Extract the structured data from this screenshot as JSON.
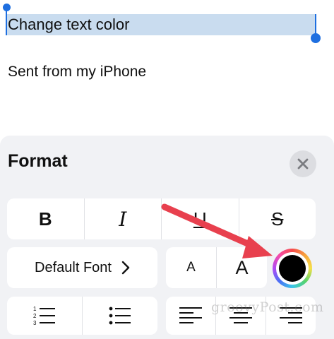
{
  "compose": {
    "selected_text": "Change text color",
    "signature": "Sent from my iPhone"
  },
  "format_panel": {
    "title": "Format",
    "close_icon": "close-icon",
    "style_buttons": {
      "bold": "B",
      "italic": "I",
      "underline": "U",
      "strikethrough": "S"
    },
    "font_button_label": "Default Font",
    "size_buttons": {
      "smaller": "A",
      "larger": "A"
    },
    "selected_color": "#000000",
    "list_icons": [
      "numbered-list-icon",
      "bulleted-list-icon"
    ],
    "align_icons": [
      "align-left-icon",
      "align-center-icon",
      "align-right-icon"
    ]
  },
  "annotation": {
    "arrow_color": "#e8404e"
  },
  "watermark": "groovyPost.com"
}
